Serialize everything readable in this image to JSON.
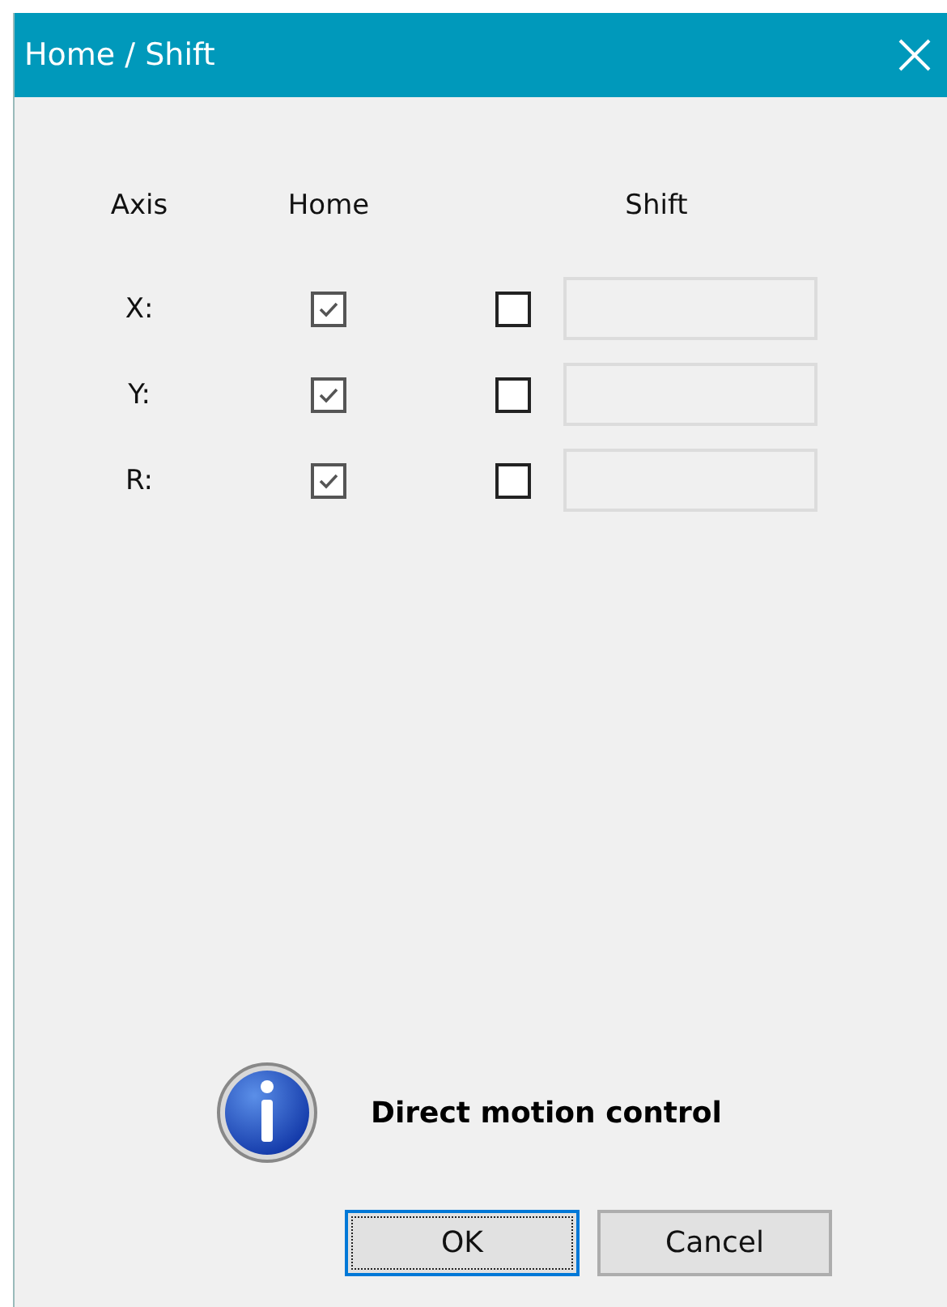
{
  "window": {
    "title": "Home / Shift"
  },
  "columns": {
    "axis": "Axis",
    "home": "Home",
    "shift": "Shift"
  },
  "axes": [
    {
      "label": "X:",
      "home_checked": true,
      "shift_checked": false,
      "shift_field_disabled": true
    },
    {
      "label": "Y:",
      "home_checked": true,
      "shift_checked": false,
      "shift_field_disabled": true
    },
    {
      "label": "R:",
      "home_checked": true,
      "shift_checked": false,
      "shift_field_disabled": true
    }
  ],
  "message": {
    "kind": "info",
    "text": "Direct motion control"
  },
  "buttons": [
    {
      "label": "OK",
      "default": true
    },
    {
      "label": "Cancel",
      "default": false
    }
  ]
}
